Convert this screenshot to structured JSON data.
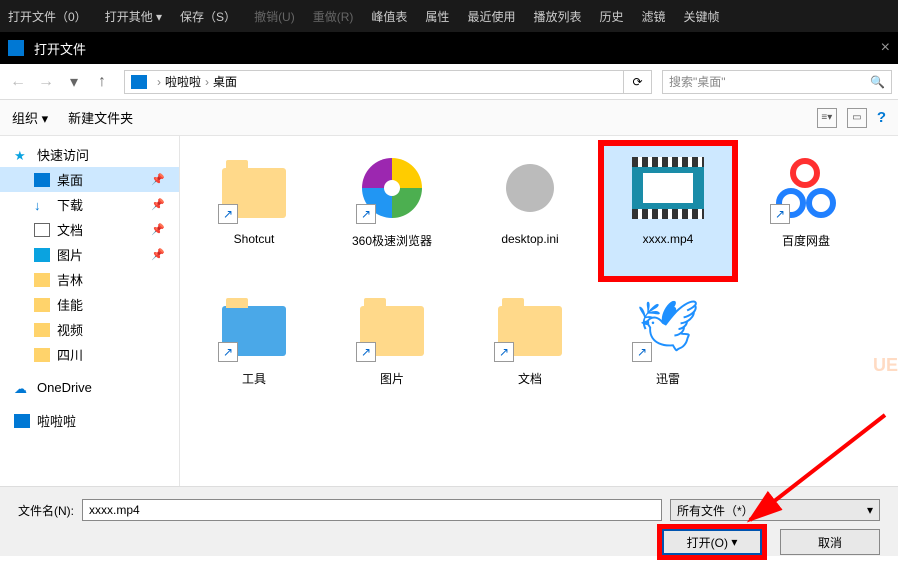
{
  "top_menu": {
    "open_file": "打开文件（0）",
    "open_other": "打开其他 ▾",
    "save": "保存（S）",
    "undo": "撤销(U)",
    "redo": "重做(R)",
    "peak_meter": "峰值表",
    "properties": "属性",
    "recent": "最近使用",
    "playlist": "播放列表",
    "history": "历史",
    "filters": "滤镜",
    "keyframes": "关键帧"
  },
  "window": {
    "title": "打开文件",
    "close": "×"
  },
  "nav": {
    "user": "啦啦啦",
    "location": "桌面",
    "search_placeholder": "搜索\"桌面\""
  },
  "toolbar": {
    "organize": "组织 ▾",
    "new_folder": "新建文件夹",
    "help": "?"
  },
  "sidebar": {
    "quick_access": "快速访问",
    "desktop": "桌面",
    "downloads": "下载",
    "documents": "文档",
    "pictures": "图片",
    "jilin": "吉林",
    "jianeng": "佳能",
    "video": "视频",
    "sichuan": "四川",
    "onedrive": "OneDrive",
    "lalala": "啦啦啦"
  },
  "files": [
    {
      "name": "Shotcut",
      "type": "folder-shortcut"
    },
    {
      "name": "360极速浏览器",
      "type": "browser-shortcut"
    },
    {
      "name": "desktop.ini",
      "type": "ini"
    },
    {
      "name": "xxxx.mp4",
      "type": "video",
      "selected": true,
      "highlighted": true
    },
    {
      "name": "百度网盘",
      "type": "baidu-shortcut"
    },
    {
      "name": "工具",
      "type": "folder-shortcut"
    },
    {
      "name": "图片",
      "type": "folder-shortcut"
    },
    {
      "name": "文档",
      "type": "folder-shortcut"
    },
    {
      "name": "迅雷",
      "type": "bird-shortcut"
    }
  ],
  "bottom": {
    "filename_label": "文件名(N):",
    "filename_value": "xxxx.mp4",
    "filetype": "所有文件（*）",
    "open": "打开(O)",
    "cancel": "取消"
  },
  "watermark": "UE"
}
